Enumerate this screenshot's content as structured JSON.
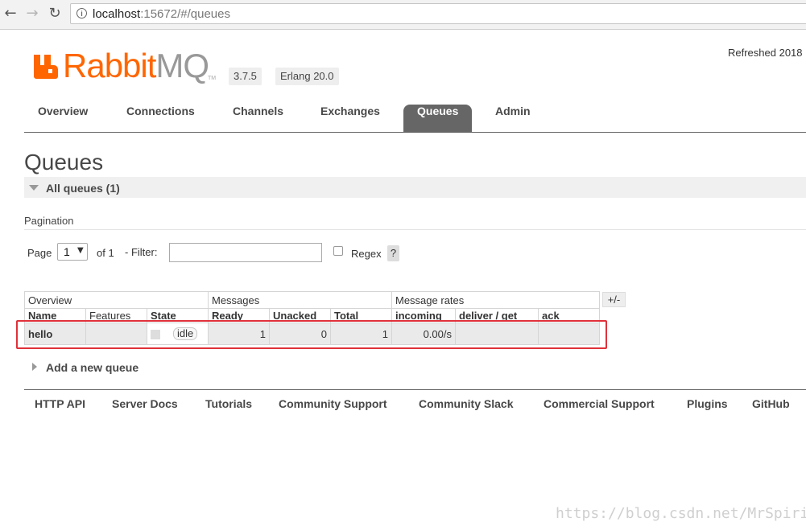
{
  "browser": {
    "url_host": "localhost",
    "url_rest": ":15672/#/queues",
    "back_icon": "arrow-left-icon",
    "forward_icon": "arrow-right-icon",
    "reload_icon": "reload-icon"
  },
  "header": {
    "logo_rabbit": "Rabbit",
    "logo_mq": "MQ",
    "logo_tm": "TM",
    "version": "3.7.5",
    "erlang": "Erlang 20.0",
    "refreshed": "Refreshed 2018"
  },
  "tabs": [
    {
      "label": "Overview",
      "active": false
    },
    {
      "label": "Connections",
      "active": false
    },
    {
      "label": "Channels",
      "active": false
    },
    {
      "label": "Exchanges",
      "active": false
    },
    {
      "label": "Queues",
      "active": true
    },
    {
      "label": "Admin",
      "active": false
    }
  ],
  "page_title": "Queues",
  "section": {
    "label": "All queues (1)"
  },
  "pagination": {
    "title": "Pagination",
    "page_label": "Page",
    "page_value": "1",
    "of_label": "of 1",
    "filter_label": "- Filter:",
    "filter_value": "",
    "regex_label": "Regex",
    "regex_checked": false,
    "help": "?"
  },
  "table": {
    "groups": [
      "Overview",
      "Messages",
      "Message rates"
    ],
    "columns": [
      "Name",
      "Features",
      "State",
      "Ready",
      "Unacked",
      "Total",
      "incoming",
      "deliver / get",
      "ack"
    ],
    "rows": [
      {
        "name": "hello",
        "features": "",
        "state": "idle",
        "ready": "1",
        "unacked": "0",
        "total": "1",
        "incoming": "0.00/s",
        "deliver_get": "",
        "ack": ""
      }
    ],
    "toggle_columns": "+/-"
  },
  "add_queue": "Add a new queue",
  "footer": [
    "HTTP API",
    "Server Docs",
    "Tutorials",
    "Community Support",
    "Community Slack",
    "Commercial Support",
    "Plugins",
    "GitHub"
  ],
  "watermark": "https://blog.csdn.net/MrSpirit",
  "colors": {
    "brand_orange": "#ff6600",
    "tab_active": "#666666",
    "highlight_red": "#e0313a"
  }
}
